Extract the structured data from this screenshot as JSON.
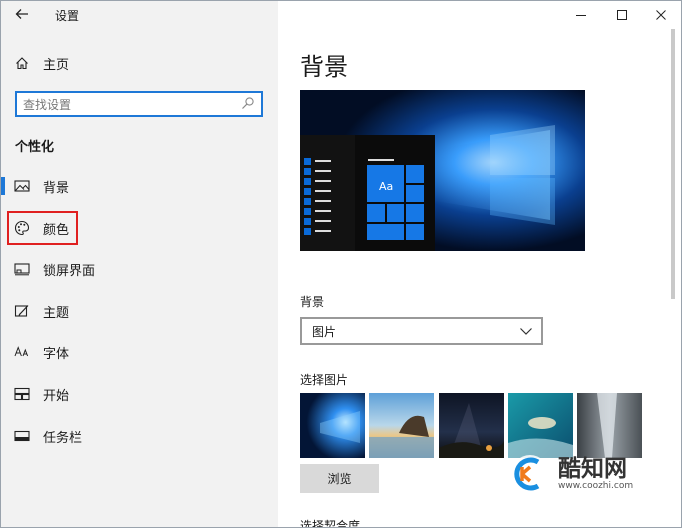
{
  "app": {
    "title": "设置",
    "back_icon": "arrow-left-icon"
  },
  "window_controls": {
    "minimize": "minimize-icon",
    "maximize": "maximize-icon",
    "close": "close-icon"
  },
  "sidebar": {
    "home_label": "主页",
    "search_placeholder": "查找设置",
    "section_title": "个性化",
    "items": [
      {
        "label": "背景",
        "icon": "image-icon",
        "selected": true
      },
      {
        "label": "颜色",
        "icon": "palette-icon",
        "highlighted": true
      },
      {
        "label": "锁屏界面",
        "icon": "lock-screen-icon"
      },
      {
        "label": "主题",
        "icon": "theme-icon"
      },
      {
        "label": "字体",
        "icon": "font-icon"
      },
      {
        "label": "开始",
        "icon": "start-icon"
      },
      {
        "label": "任务栏",
        "icon": "taskbar-icon"
      }
    ]
  },
  "main": {
    "title": "背景",
    "preview_tile_text": "Aa",
    "background_label": "背景",
    "background_value": "图片",
    "choose_picture_label": "选择图片",
    "browse_label": "浏览",
    "fit_label": "选择契合度"
  },
  "watermark": {
    "text": "酷知网",
    "url": "www.coozhi.com"
  },
  "colors": {
    "accent": "#1e78d7",
    "sidebar_bg": "#f2f2f2",
    "highlight_border": "#e02020"
  }
}
